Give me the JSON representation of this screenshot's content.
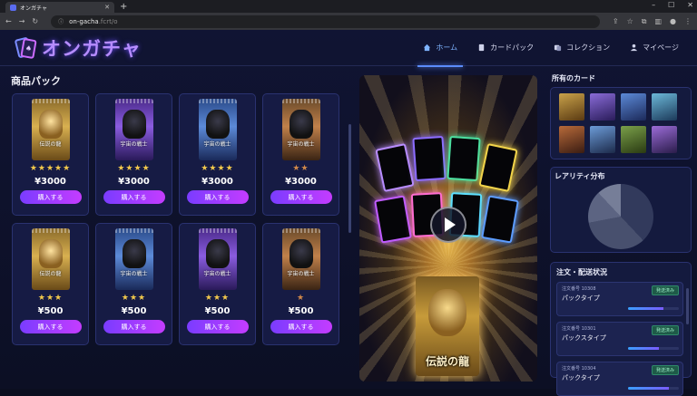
{
  "browser": {
    "tab_title": "オンガチャ",
    "url_host": "on-gacha",
    "url_path": ".fcrt/o"
  },
  "header": {
    "logo_text": "オンガチャ",
    "nav": [
      {
        "label": "ホーム",
        "icon": "home-icon",
        "active": true
      },
      {
        "label": "カードパック",
        "icon": "card-pack-icon",
        "active": false
      },
      {
        "label": "コレクション",
        "icon": "collection-icon",
        "active": false
      },
      {
        "label": "マイページ",
        "icon": "user-icon",
        "active": false
      }
    ]
  },
  "products": {
    "title": "商品パック",
    "buy_label": "購入する",
    "items": [
      {
        "name": "伝説の龍",
        "price": "¥3000",
        "stars": 5,
        "theme": "gold"
      },
      {
        "name": "宇宙の戦士",
        "price": "¥3000",
        "stars": 4,
        "theme": "purple"
      },
      {
        "name": "宇宙の戦士",
        "price": "¥3000",
        "stars": 4,
        "theme": "blue"
      },
      {
        "name": "宇宙の戦士",
        "price": "¥3000",
        "stars": 2,
        "theme": "bronze"
      },
      {
        "name": "伝説の龍",
        "price": "¥500",
        "stars": 3,
        "theme": "gold"
      },
      {
        "name": "宇宙の戦士",
        "price": "¥500",
        "stars": 3,
        "theme": "blue"
      },
      {
        "name": "宇宙の戦士",
        "price": "¥500",
        "stars": 3,
        "theme": "purple"
      },
      {
        "name": "宇宙の戦士",
        "price": "¥500",
        "stars": 1,
        "theme": "bronze"
      }
    ]
  },
  "showcase": {
    "pack_label": "伝説の龍"
  },
  "sidebar": {
    "owned_title": "所有のカード",
    "rarity_title": "レアリティ分布",
    "rarity_chart": {
      "type": "pie",
      "slices": [
        38,
        34,
        16,
        12
      ]
    },
    "orders_title": "注文・配送状況",
    "orders": [
      {
        "number": "注文番号 10308",
        "type": "パックタイプ",
        "status": "発送済み",
        "progress": 0.7
      },
      {
        "number": "注文番号 10301",
        "type": "パックスタイプ",
        "status": "発送済み",
        "progress": 0.6
      },
      {
        "number": "注文番号 10304",
        "type": "パックタイプ",
        "status": "発送済み",
        "progress": 0.8
      }
    ]
  },
  "colors": {
    "accent": "#7a3cff",
    "accent2": "#c43cff",
    "background": "#0b0e1f"
  }
}
